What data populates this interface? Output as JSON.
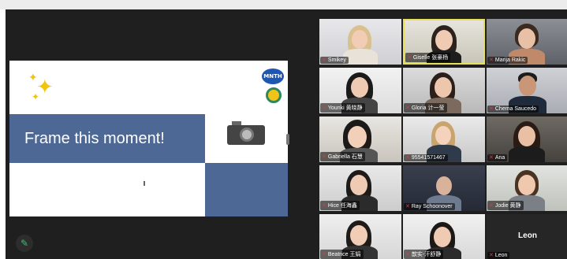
{
  "presentation": {
    "slide_title": "Frame this moment!",
    "logo_text": "MNTH"
  },
  "gallery": {
    "participants": [
      {
        "name": "Smikey"
      },
      {
        "name": "Giselle 张豪杨"
      },
      {
        "name": "Marija Rakic"
      },
      {
        "name": "Younki 黄晓静"
      },
      {
        "name": "Gloria 计一莹"
      },
      {
        "name": "Chema Saucedo"
      },
      {
        "name": "Gabriella 石慧"
      },
      {
        "name": "95541571467"
      },
      {
        "name": "Ana"
      },
      {
        "name": "Hice 任海鑫"
      },
      {
        "name": "Ray Schoonover"
      },
      {
        "name": "Jodie 黄静"
      },
      {
        "name": "Beatrice 王娟"
      },
      {
        "name": "歆实-汗舒静"
      },
      {
        "name": "Leon",
        "display_name": "Leon"
      }
    ]
  },
  "icons": {
    "mic_muted": "mic-muted-icon",
    "annotate": "pencil-icon"
  },
  "colors": {
    "slide_accent": "#4d6894",
    "active_speaker": "#e6e05a",
    "muted": "#e03b3b"
  }
}
